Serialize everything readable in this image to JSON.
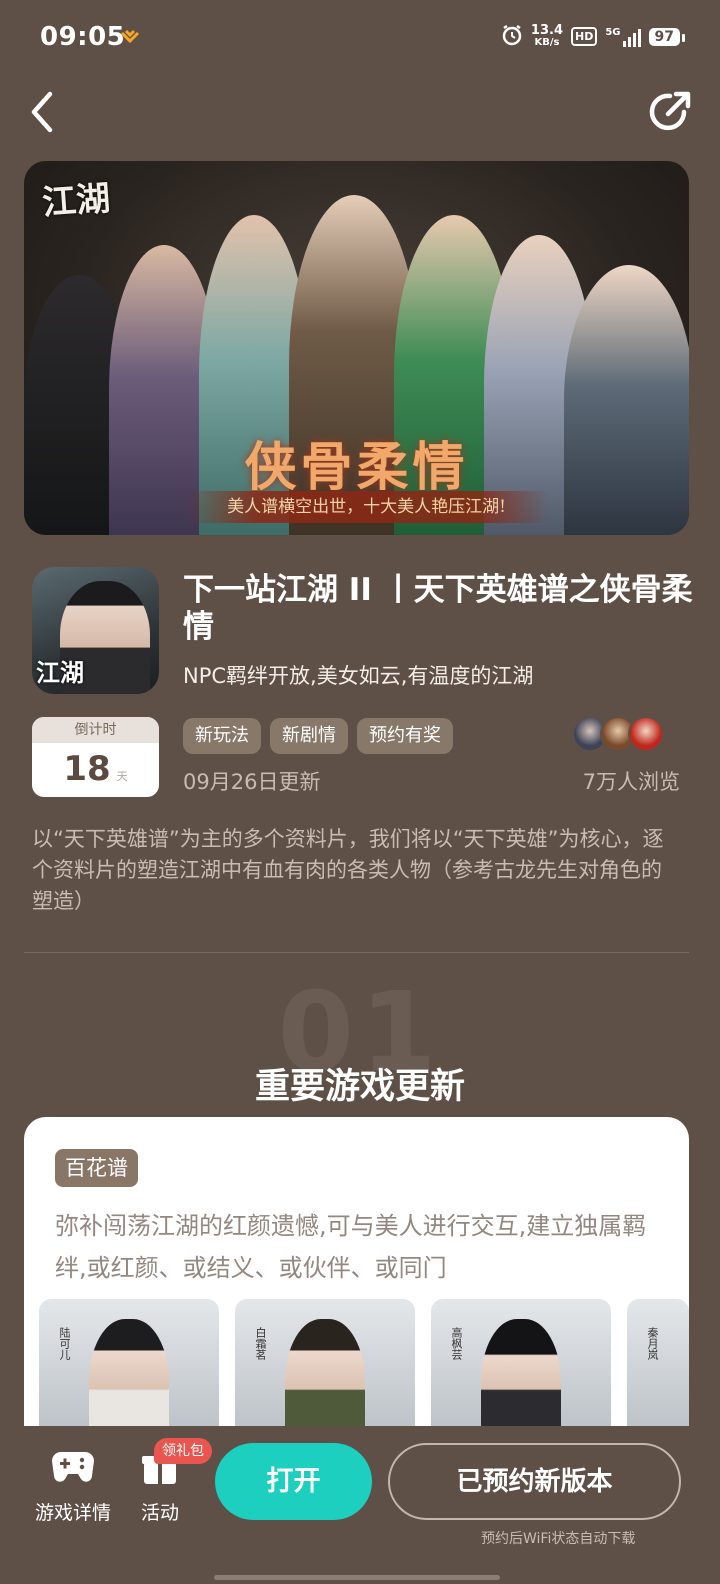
{
  "status_bar": {
    "time": "09:05",
    "net_speed_value": "13.4",
    "net_speed_unit": "KB/s",
    "hd": "HD",
    "network": "5G",
    "battery": "97"
  },
  "banner": {
    "logo_text": "江湖",
    "title": "侠骨柔情",
    "subtitle": "美人谱横空出世，十大美人艳压江湖!"
  },
  "app": {
    "icon_text": "江湖",
    "title": "下一站江湖 II 丨天下英雄谱之侠骨柔情",
    "subtitle": "NPC羁绊开放,美女如云,有温度的江湖"
  },
  "countdown": {
    "label": "倒计时",
    "value": "18",
    "unit": "天"
  },
  "tags": [
    "新玩法",
    "新剧情",
    "预约有奖"
  ],
  "update_date": "09月26日更新",
  "viewers": "7万人浏览",
  "description": "以“天下英雄谱”为主的多个资料片，我们将以“天下英雄”为核心，逐个资料片的塑造江湖中有血有肉的各类人物（参考古龙先生对角色的塑造）",
  "section": {
    "number": "01",
    "title": "重要游戏更新"
  },
  "card": {
    "tag": "百花谱",
    "description": "弥补闯荡江湖的红颜遗憾,可与美人进行交互,建立独属羁绊,或红颜、或结义、或伙伴、或同门",
    "portraits": [
      {
        "name": "陆可儿"
      },
      {
        "name": "白霜茗"
      },
      {
        "name": "高枫芸"
      },
      {
        "name": "秦月岚"
      }
    ]
  },
  "bottom_bar": {
    "details_label": "游戏详情",
    "activity_label": "活动",
    "gift_badge": "领礼包",
    "open_label": "打开",
    "reserved_label": "已预约新版本",
    "wifi_note": "预约后WiFi状态自动下载"
  },
  "colors": {
    "background": "#5f5047",
    "accent": "#1ccfbf",
    "badge": "#e8564f",
    "tag": "#877869"
  }
}
